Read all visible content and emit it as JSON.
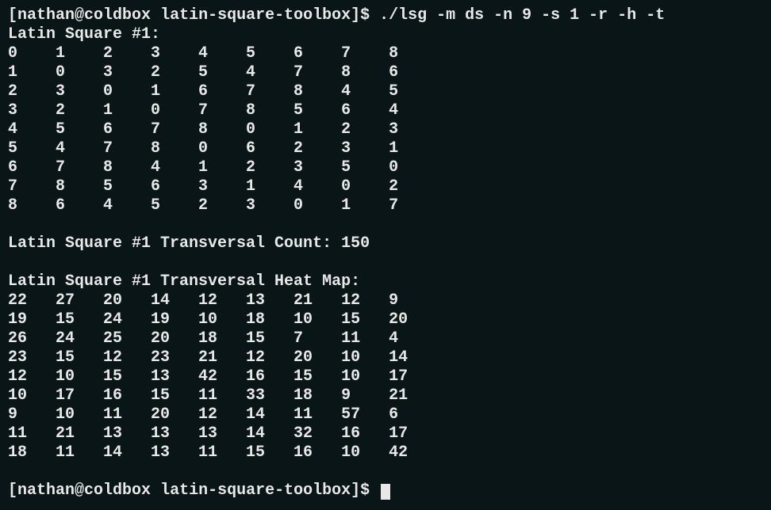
{
  "prompt1": {
    "user": "nathan",
    "host": "coldbox",
    "cwd": "latin-square-toolbox",
    "command": "./lsg -m ds -n 9 -s 1 -r -h -t"
  },
  "square_header": "Latin Square #1:",
  "square": [
    [
      0,
      1,
      2,
      3,
      4,
      5,
      6,
      7,
      8
    ],
    [
      1,
      0,
      3,
      2,
      5,
      4,
      7,
      8,
      6
    ],
    [
      2,
      3,
      0,
      1,
      6,
      7,
      8,
      4,
      5
    ],
    [
      3,
      2,
      1,
      0,
      7,
      8,
      5,
      6,
      4
    ],
    [
      4,
      5,
      6,
      7,
      8,
      0,
      1,
      2,
      3
    ],
    [
      5,
      4,
      7,
      8,
      0,
      6,
      2,
      3,
      1
    ],
    [
      6,
      7,
      8,
      4,
      1,
      2,
      3,
      5,
      0
    ],
    [
      7,
      8,
      5,
      6,
      3,
      1,
      4,
      0,
      2
    ],
    [
      8,
      6,
      4,
      5,
      2,
      3,
      0,
      1,
      7
    ]
  ],
  "transversal_count_label": "Latin Square #1 Transversal Count:",
  "transversal_count": 150,
  "heatmap_header": "Latin Square #1 Transversal Heat Map:",
  "heatmap": [
    [
      22,
      27,
      20,
      14,
      12,
      13,
      21,
      12,
      9
    ],
    [
      19,
      15,
      24,
      19,
      10,
      18,
      10,
      15,
      20
    ],
    [
      26,
      24,
      25,
      20,
      18,
      15,
      7,
      11,
      4
    ],
    [
      23,
      15,
      12,
      23,
      21,
      12,
      20,
      10,
      14
    ],
    [
      12,
      10,
      15,
      13,
      42,
      16,
      15,
      10,
      17
    ],
    [
      10,
      17,
      16,
      15,
      11,
      33,
      18,
      9,
      21
    ],
    [
      9,
      10,
      11,
      20,
      12,
      14,
      11,
      57,
      6
    ],
    [
      11,
      21,
      13,
      13,
      13,
      14,
      32,
      16,
      17
    ],
    [
      18,
      11,
      14,
      13,
      11,
      15,
      16,
      10,
      42
    ]
  ],
  "prompt2": {
    "user": "nathan",
    "host": "coldbox",
    "cwd": "latin-square-toolbox"
  }
}
